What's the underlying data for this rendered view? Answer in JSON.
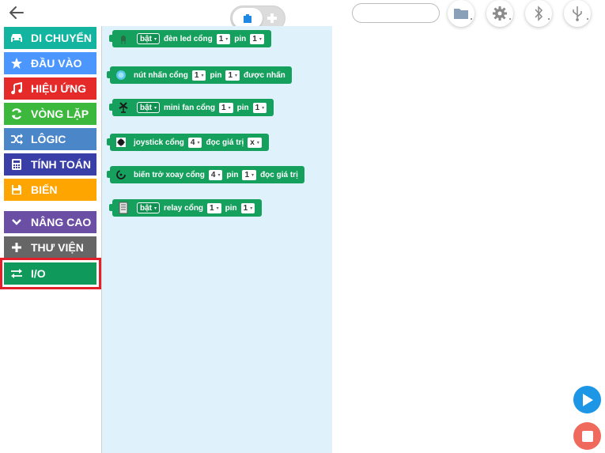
{
  "topbar": {
    "back": "back-arrow-icon",
    "mode_toggle": {
      "active": "blocks-icon",
      "inactive": "plus-icon"
    },
    "search": {
      "value": "",
      "placeholder": ""
    },
    "tools": [
      "folder-icon",
      "gear-icon",
      "bluetooth-icon",
      "usb-icon"
    ]
  },
  "categories": [
    {
      "label": "DI CHUYỂN",
      "color": "#13b5a0",
      "icon": "car-icon"
    },
    {
      "label": "ĐẦU VÀO",
      "color": "#4c97ff",
      "icon": "star-icon"
    },
    {
      "label": "HIỆU ỨNG",
      "color": "#e52a2a",
      "icon": "music-note-icon"
    },
    {
      "label": "VÒNG LẶP",
      "color": "#3cb93c",
      "icon": "refresh-icon"
    },
    {
      "label": "LÔGIC",
      "color": "#4a86c8",
      "icon": "shuffle-icon"
    },
    {
      "label": "TÍNH TOÁN",
      "color": "#3a3fa8",
      "icon": "calculator-icon"
    },
    {
      "label": "BIẾN",
      "color": "#ffa500",
      "icon": "floppy-icon"
    },
    {
      "label": "NÂNG CAO",
      "color": "#6b4fa5",
      "icon": "chevron-down-icon"
    },
    {
      "label": "THƯ VIỆN",
      "color": "#666666",
      "icon": "plus-icon"
    },
    {
      "label": "I/O",
      "color": "#0f9a5b",
      "icon": "swap-icon",
      "selected": true
    }
  ],
  "blocks": [
    {
      "icon": "led-icon",
      "parts": [
        {
          "t": "dd",
          "v": "bật"
        },
        {
          "t": "w",
          "v": "đèn led cổng"
        },
        {
          "t": "n",
          "v": "1"
        },
        {
          "t": "w",
          "v": "pin"
        },
        {
          "t": "n",
          "v": "1"
        }
      ]
    },
    {
      "icon": "button-icon",
      "parts": [
        {
          "t": "w",
          "v": "nút nhấn cổng"
        },
        {
          "t": "n",
          "v": "1"
        },
        {
          "t": "w",
          "v": "pin"
        },
        {
          "t": "n",
          "v": "1"
        },
        {
          "t": "w",
          "v": "được nhấn"
        }
      ]
    },
    {
      "icon": "fan-icon",
      "parts": [
        {
          "t": "dd",
          "v": "bật"
        },
        {
          "t": "w",
          "v": "mini fan cổng"
        },
        {
          "t": "n",
          "v": "1"
        },
        {
          "t": "w",
          "v": "pin"
        },
        {
          "t": "n",
          "v": "1"
        }
      ]
    },
    {
      "icon": "joystick-icon",
      "parts": [
        {
          "t": "w",
          "v": "joystick cổng"
        },
        {
          "t": "n",
          "v": "4"
        },
        {
          "t": "w",
          "v": "đọc giá trị"
        },
        {
          "t": "n",
          "v": "x"
        }
      ]
    },
    {
      "icon": "potentiometer-icon",
      "parts": [
        {
          "t": "w",
          "v": "biến trở xoay cổng"
        },
        {
          "t": "n",
          "v": "4"
        },
        {
          "t": "w",
          "v": "pin"
        },
        {
          "t": "n",
          "v": "1"
        },
        {
          "t": "w",
          "v": "đọc giá trị"
        }
      ]
    },
    {
      "icon": "relay-icon",
      "parts": [
        {
          "t": "dd",
          "v": "bật"
        },
        {
          "t": "w",
          "v": "relay cổng"
        },
        {
          "t": "n",
          "v": "1"
        },
        {
          "t": "w",
          "v": "pin"
        },
        {
          "t": "n",
          "v": "1"
        }
      ]
    }
  ],
  "controls": {
    "run": "play-icon",
    "stop": "stop-icon"
  }
}
